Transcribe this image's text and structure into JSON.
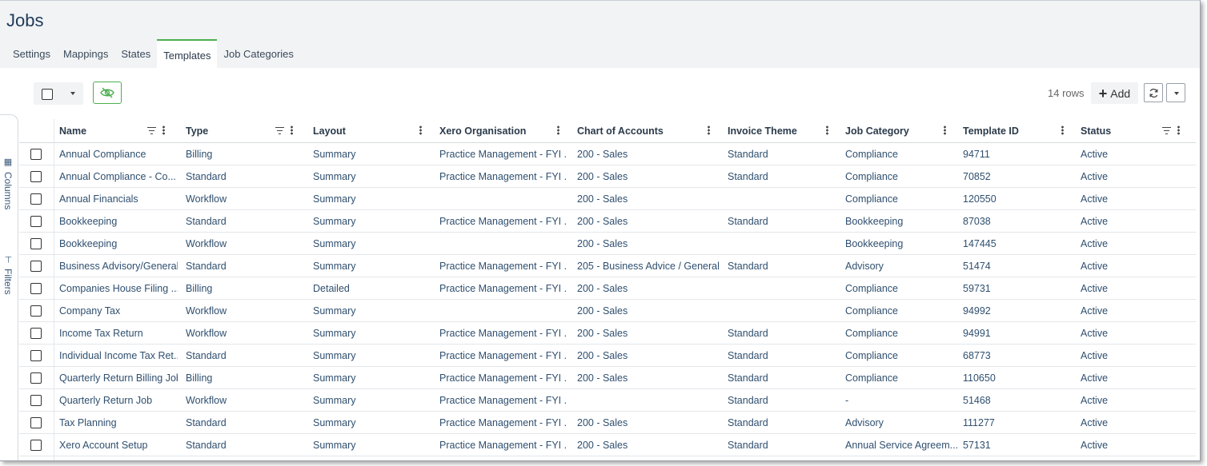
{
  "page": {
    "title": "Jobs"
  },
  "tabs": [
    {
      "label": "Settings"
    },
    {
      "label": "Mappings"
    },
    {
      "label": "States"
    },
    {
      "label": "Templates",
      "active": true
    },
    {
      "label": "Job Categories"
    }
  ],
  "toolbar": {
    "rows_count": "14 rows",
    "add_label": "Add"
  },
  "side_panel": {
    "columns_label": "Columns",
    "filters_label": "Filters"
  },
  "columns": [
    {
      "label": "Name",
      "filter": true
    },
    {
      "label": "Type",
      "filter": true
    },
    {
      "label": "Layout",
      "filter": false
    },
    {
      "label": "Xero Organisation",
      "filter": false
    },
    {
      "label": "Chart of Accounts",
      "filter": false
    },
    {
      "label": "Invoice Theme",
      "filter": false
    },
    {
      "label": "Job Category",
      "filter": false
    },
    {
      "label": "Template ID",
      "filter": false
    },
    {
      "label": "Status",
      "filter": true
    }
  ],
  "rows": [
    [
      "Annual Compliance",
      "Billing",
      "Summary",
      "Practice Management - FYI ...",
      "200 - Sales",
      "Standard",
      "Compliance",
      "94711",
      "Active"
    ],
    [
      "Annual Compliance - Co...",
      "Standard",
      "Summary",
      "Practice Management - FYI ...",
      "200 - Sales",
      "Standard",
      "Compliance",
      "70852",
      "Active"
    ],
    [
      "Annual Financials",
      "Workflow",
      "Summary",
      "",
      "200 - Sales",
      "",
      "Compliance",
      "120550",
      "Active"
    ],
    [
      "Bookkeeping",
      "Standard",
      "Summary",
      "Practice Management - FYI ...",
      "200 - Sales",
      "Standard",
      "Bookkeeping",
      "87038",
      "Active"
    ],
    [
      "Bookkeeping",
      "Workflow",
      "Summary",
      "",
      "200 - Sales",
      "",
      "Bookkeeping",
      "147445",
      "Active"
    ],
    [
      "Business Advisory/General",
      "Standard",
      "Summary",
      "Practice Management - FYI ...",
      "205 - Business Advice / General",
      "Standard",
      "Advisory",
      "51474",
      "Active"
    ],
    [
      "Companies House Filing ...",
      "Billing",
      "Detailed",
      "Practice Management - FYI ...",
      "200 - Sales",
      "",
      "Compliance",
      "59731",
      "Active"
    ],
    [
      "Company Tax",
      "Workflow",
      "Summary",
      "",
      "200 - Sales",
      "",
      "Compliance",
      "94992",
      "Active"
    ],
    [
      "Income Tax Return",
      "Workflow",
      "Summary",
      "Practice Management - FYI ...",
      "200 - Sales",
      "Standard",
      "Compliance",
      "94991",
      "Active"
    ],
    [
      "Individual Income Tax Ret...",
      "Standard",
      "Summary",
      "Practice Management - FYI ...",
      "200 - Sales",
      "Standard",
      "Compliance",
      "68773",
      "Active"
    ],
    [
      "Quarterly Return Billing Job",
      "Billing",
      "Summary",
      "Practice Management - FYI ...",
      "200 - Sales",
      "Standard",
      "Compliance",
      "110650",
      "Active"
    ],
    [
      "Quarterly Return Job",
      "Workflow",
      "Summary",
      "Practice Management - FYI ...",
      "",
      "Standard",
      "-",
      "51468",
      "Active"
    ],
    [
      "Tax Planning",
      "Standard",
      "Summary",
      "Practice Management - FYI ...",
      "200 - Sales",
      "Standard",
      "Advisory",
      "111277",
      "Active"
    ],
    [
      "Xero Account Setup",
      "Standard",
      "Summary",
      "Practice Management - FYI ...",
      "200 - Sales",
      "Standard",
      "Annual Service Agreem...",
      "57131",
      "Active"
    ]
  ],
  "colors": {
    "accent": "#4caf50",
    "title": "#1f3b58",
    "link": "#2f4f6f",
    "header_bg": "#f1f3f5"
  }
}
